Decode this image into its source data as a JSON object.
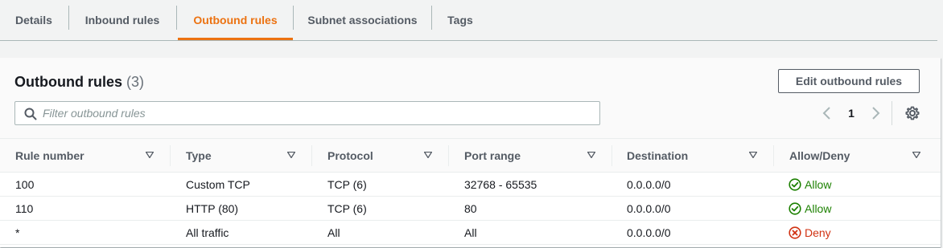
{
  "tabs": [
    {
      "label": "Details"
    },
    {
      "label": "Inbound rules"
    },
    {
      "label": "Outbound rules"
    },
    {
      "label": "Subnet associations"
    },
    {
      "label": "Tags"
    }
  ],
  "panel": {
    "title": "Outbound rules",
    "count": "(3)",
    "edit_button": "Edit outbound rules",
    "search_placeholder": "Filter outbound rules",
    "page_number": "1"
  },
  "table": {
    "columns": [
      "Rule number",
      "Type",
      "Protocol",
      "Port range",
      "Destination",
      "Allow/Deny"
    ],
    "rows": [
      {
        "rule_number": "100",
        "type": "Custom TCP",
        "protocol": "TCP (6)",
        "port_range": "32768 - 65535",
        "destination": "0.0.0.0/0",
        "action": "Allow"
      },
      {
        "rule_number": "110",
        "type": "HTTP (80)",
        "protocol": "TCP (6)",
        "port_range": "80",
        "destination": "0.0.0.0/0",
        "action": "Allow"
      },
      {
        "rule_number": "*",
        "type": "All traffic",
        "protocol": "All",
        "port_range": "All",
        "destination": "0.0.0.0/0",
        "action": "Deny"
      }
    ]
  },
  "colors": {
    "accent": "#ec7211",
    "allow": "#1d8102",
    "deny": "#d13212"
  },
  "icons": {
    "search": "search-icon",
    "prev": "chevron-left-icon",
    "next": "chevron-right-icon",
    "settings": "gear-icon",
    "sort": "caret-down-icon",
    "allow": "check-circle-icon",
    "deny": "x-circle-icon"
  }
}
